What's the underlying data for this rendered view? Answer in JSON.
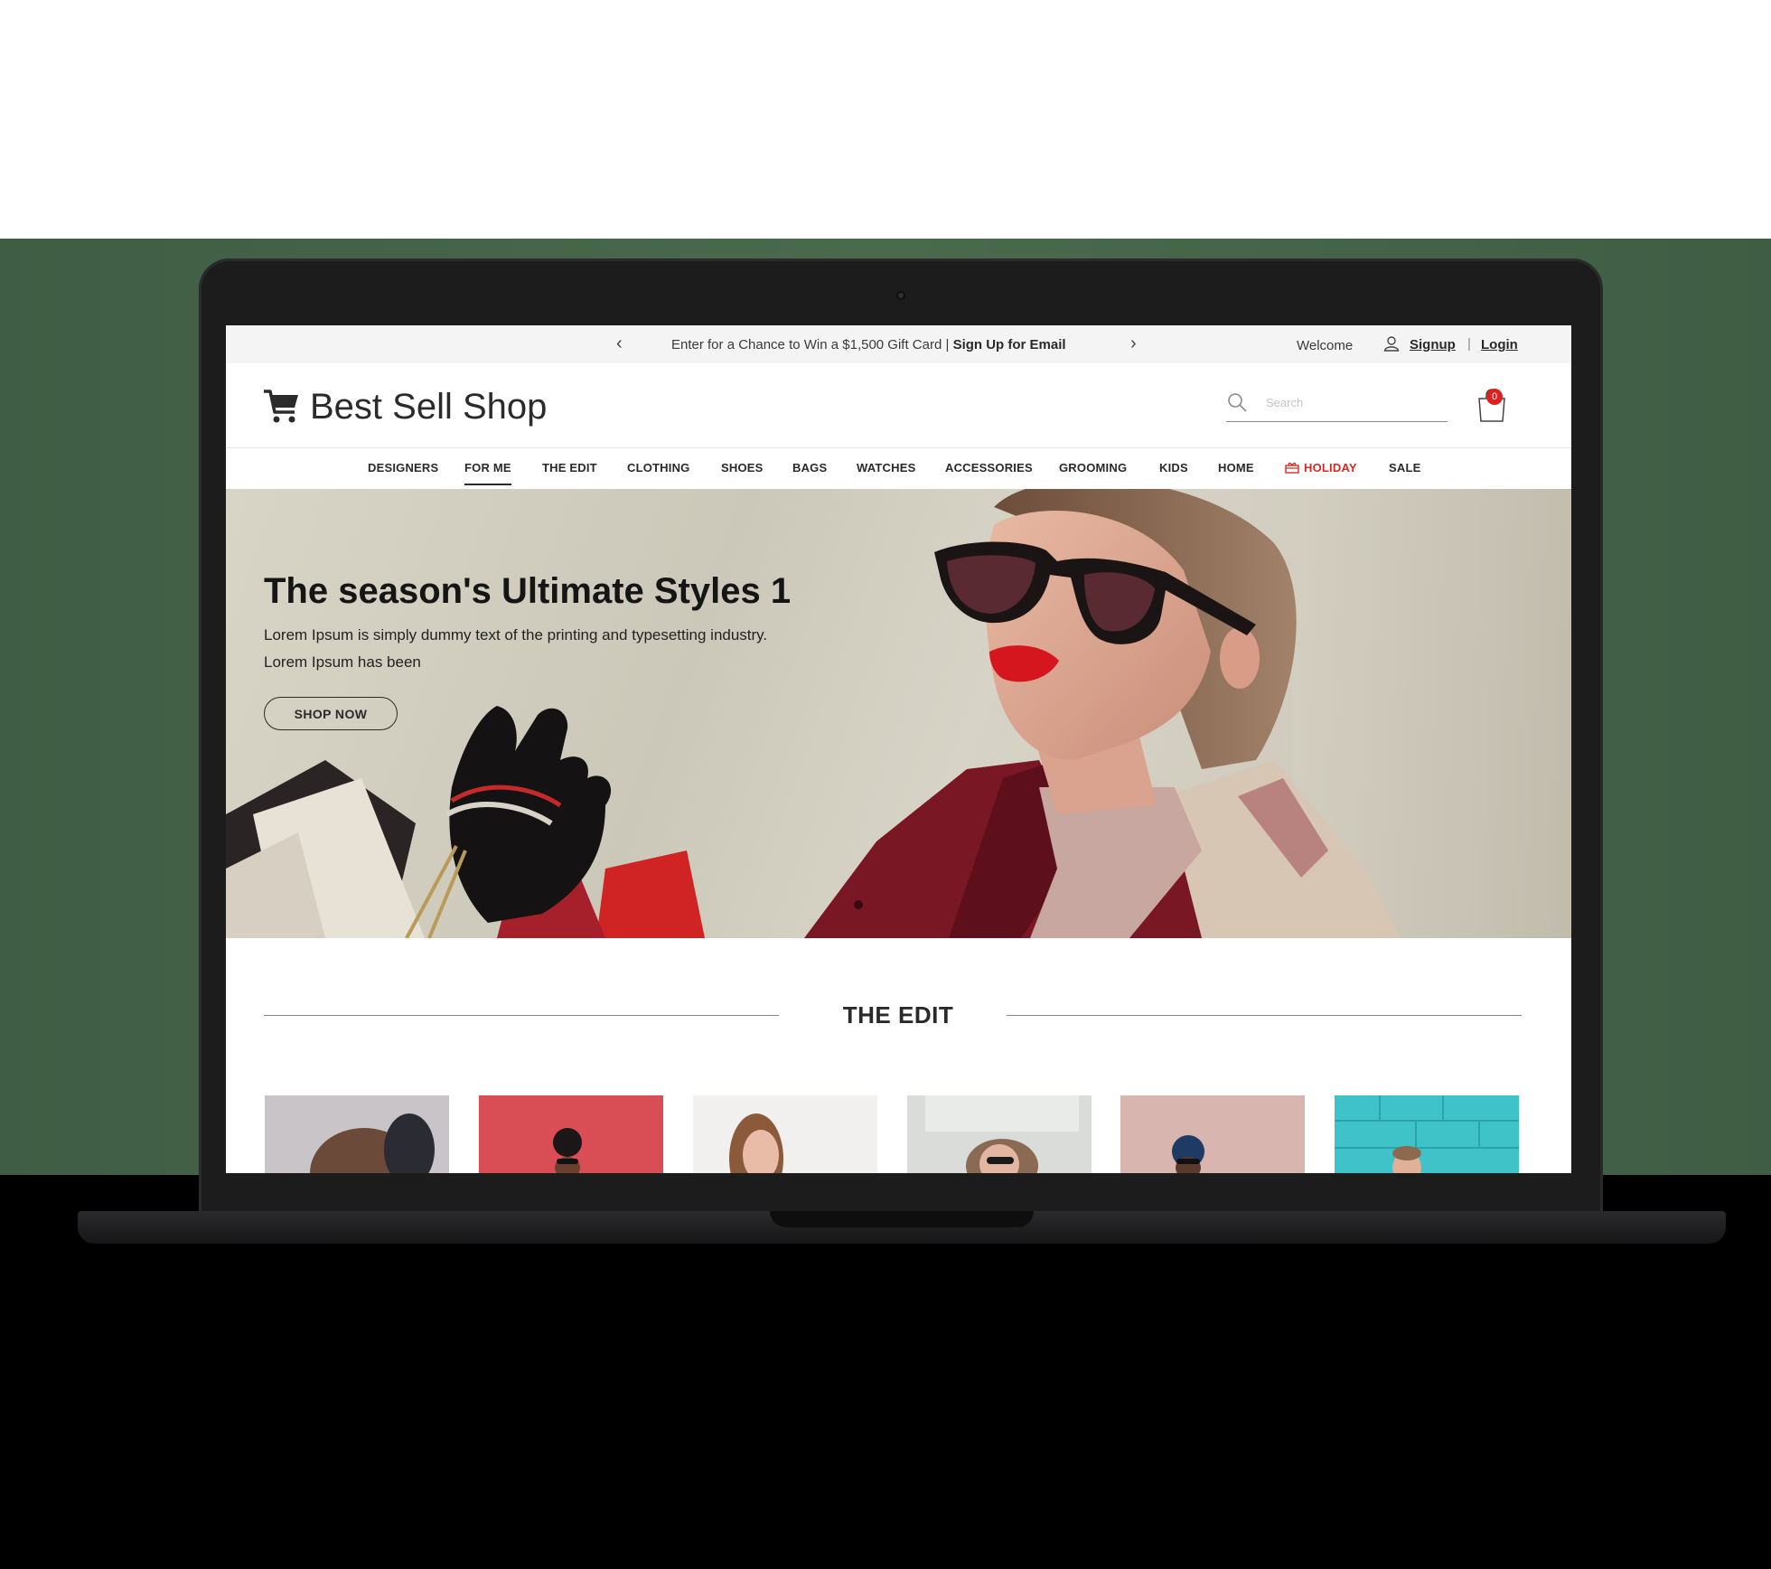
{
  "topbar": {
    "promo_text": "Enter for a Chance to Win a $1,500 Gift Card | ",
    "promo_cta": "Sign Up for Email",
    "welcome": "Welcome",
    "signup": "Signup",
    "separator": "|",
    "login": "Login",
    "prev_icon": "chevron-left-icon",
    "next_icon": "chevron-right-icon"
  },
  "header": {
    "brand": "Best Sell Shop",
    "logo_icon": "shopping-cart-icon",
    "search_placeholder": "Search",
    "cart_count": "0"
  },
  "nav": {
    "items": [
      {
        "label": "DESIGNERS"
      },
      {
        "label": "FOR ME",
        "active": true
      },
      {
        "label": "THE EDIT"
      },
      {
        "label": "CLOTHING"
      },
      {
        "label": "SHOES"
      },
      {
        "label": "BAGS"
      },
      {
        "label": "WATCHES"
      },
      {
        "label": "ACCESSORIES"
      },
      {
        "label": "GROOMING"
      },
      {
        "label": "KIDS"
      },
      {
        "label": "HOME"
      },
      {
        "label": "HOLIDAY",
        "icon": "gift-icon"
      },
      {
        "label": "SALE"
      }
    ]
  },
  "hero": {
    "title": "The season's Ultimate Styles 1",
    "text": "Lorem Ipsum is simply dummy text of the printing and typesetting industry. Lorem Ipsum has been",
    "button": "SHOP NOW"
  },
  "section": {
    "title": "THE EDIT"
  },
  "colors": {
    "accent_red": "#d42a24",
    "badge_red": "#e0201e",
    "text_dark": "#2a2a2a",
    "topbar_bg": "#f4f4f4",
    "laptop_body": "#1c1c1d"
  }
}
